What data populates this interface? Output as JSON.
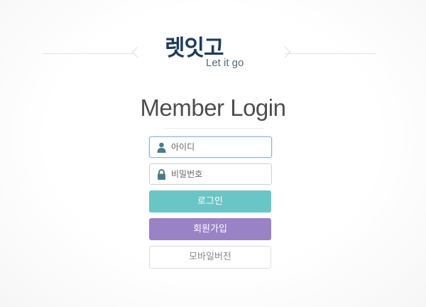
{
  "logo": {
    "korean": "렛잇고",
    "english": "Let it go"
  },
  "title": "Member Login",
  "form": {
    "id_placeholder": "아이디",
    "password_placeholder": "비밀번호",
    "login_label": "로그인",
    "join_label": "회원가입",
    "mobile_label": "모바일버전"
  },
  "icons": {
    "id": "user-icon",
    "password": "lock-icon"
  },
  "colors": {
    "login_button": "#69c5c6",
    "join_button": "#9a82c6",
    "logo": "#1f3b5a",
    "title": "#4e4e4e"
  }
}
